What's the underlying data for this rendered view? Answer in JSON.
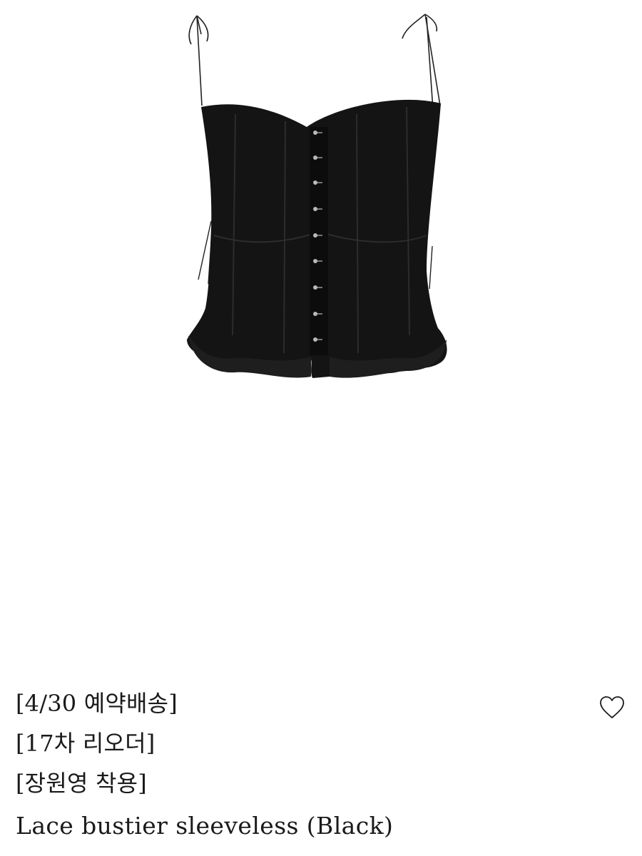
{
  "product": {
    "image_alt": "Lace bustier sleeveless (Black)",
    "garment_color": "#141414",
    "tags": [
      "[4/30 예약배송]",
      "[17차 리오더]",
      "[장원영 착용]"
    ],
    "title": "Lace bustier sleeveless (Black)"
  },
  "actions": {
    "wishlist_icon": "heart-outline-icon"
  }
}
